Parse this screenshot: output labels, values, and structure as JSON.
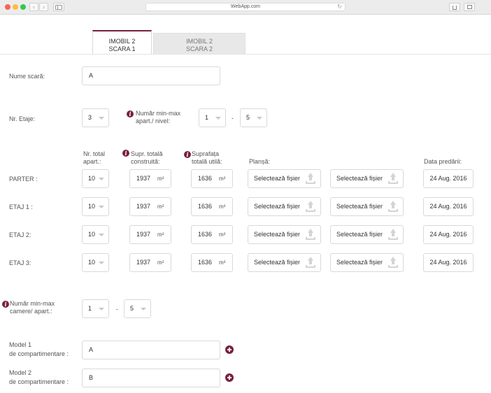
{
  "browser": {
    "url": "WebApp.com"
  },
  "tabs": [
    {
      "line1": "IMOBIL 2",
      "line2": "SCARA 1"
    },
    {
      "line1": "IMOBIL 2",
      "line2": "SCARA 2"
    }
  ],
  "form": {
    "scara_label": "Nume scară:",
    "scara_value": "A",
    "etaje_label": "Nr. Etaje:",
    "etaje_value": "3",
    "apart_nivel_label": "Număr min-max apart./ nivel:",
    "apart_nivel_min": "1",
    "apart_nivel_max": "5",
    "range_sep": "-"
  },
  "table": {
    "headers": {
      "total_apart": "Nr. total apart.:",
      "supr_construita": "Supr. totală construită:",
      "supr_utila": "Suprafața totală utilă:",
      "plansa": "Planșă:",
      "data": "Data predării:"
    },
    "unit": "m²",
    "file_label": "Selectează fișier",
    "rows": [
      {
        "label": "PARTER :",
        "total": "10",
        "construita": "1937",
        "utila": "1636",
        "date": "24 Aug. 2016"
      },
      {
        "label": "ETAJ 1 :",
        "total": "10",
        "construita": "1937",
        "utila": "1636",
        "date": "24 Aug. 2016"
      },
      {
        "label": "ETAJ 2:",
        "total": "10",
        "construita": "1937",
        "utila": "1636",
        "date": "24 Aug. 2016"
      },
      {
        "label": "ETAJ 3:",
        "total": "10",
        "construita": "1937",
        "utila": "1636",
        "date": "24 Aug. 2016"
      }
    ]
  },
  "camere": {
    "label": "Număr min-max camere/ apart.:",
    "min": "1",
    "max": "5"
  },
  "models": [
    {
      "label_line1": "Model 1",
      "label_line2": "de compartimentare :",
      "value": "A"
    },
    {
      "label_line1": "Model 2",
      "label_line2": "de compartimentare :",
      "value": "B"
    }
  ],
  "colors": {
    "accent": "#7a1f40"
  }
}
